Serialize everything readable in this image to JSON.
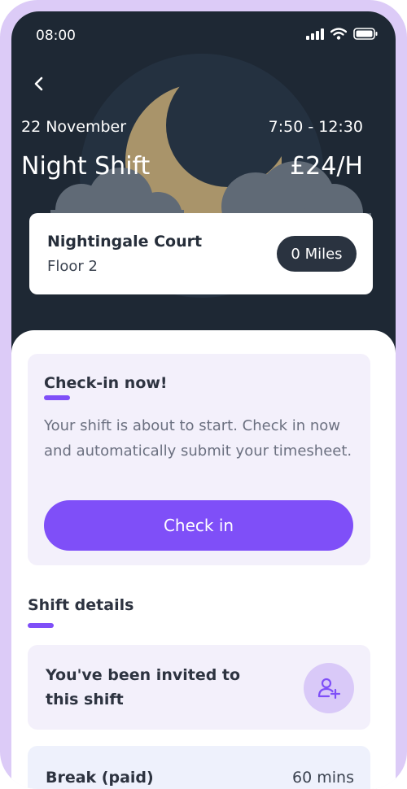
{
  "status_bar": {
    "time": "08:00"
  },
  "header": {
    "date": "22 November",
    "hours": "7:50 - 12:30",
    "title": "Night Shift",
    "rate": "£24/H"
  },
  "location": {
    "name": "Nightingale Court",
    "floor": "Floor 2",
    "distance": "0 Miles"
  },
  "checkin": {
    "title": "Check-in now!",
    "body": "Your shift is about to start. Check in now and automatically submit your timesheet.",
    "button_label": "Check in"
  },
  "details": {
    "title": "Shift details",
    "invite_text": "You've been invited to this shift",
    "break_label": "Break (paid)",
    "break_value": "60 mins"
  },
  "colors": {
    "accent": "#7f4ff8",
    "hero_background": "#1e2834",
    "frame": "#dccbf7",
    "card_background": "#f3f0fb"
  },
  "icons": [
    "signal-icon",
    "wifi-icon",
    "battery-icon",
    "back-arrow-icon",
    "moon-illustration",
    "add-user-icon"
  ]
}
